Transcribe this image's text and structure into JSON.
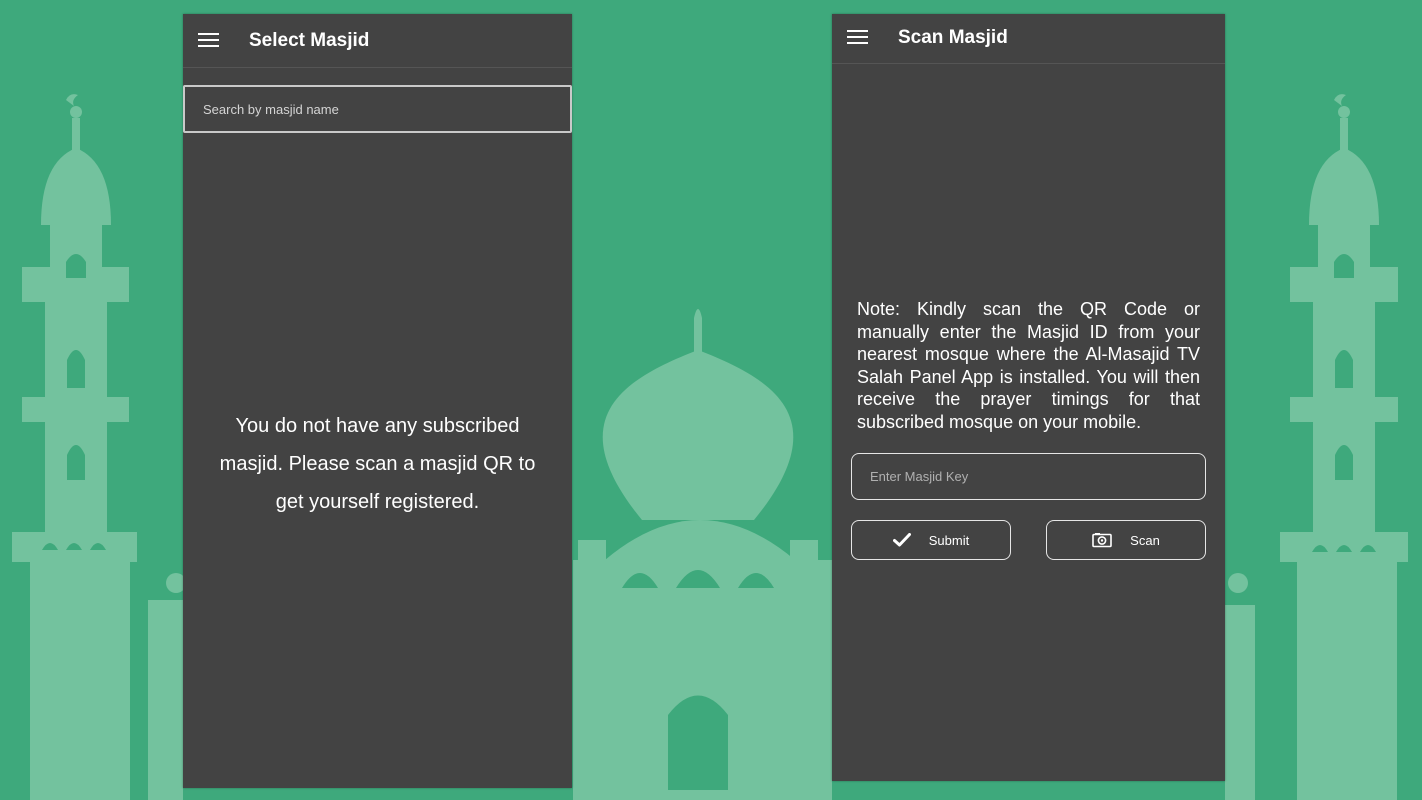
{
  "colors": {
    "background": "#3ea97c",
    "silhouette": "#73c29e",
    "panel": "#434343",
    "text": "#ffffff"
  },
  "select_screen": {
    "title": "Select Masjid",
    "menu_icon": "hamburger-menu-icon",
    "search_placeholder": "Search by masjid name",
    "empty_message": "You do not have any subscribed masjid. Please scan a masjid QR to get yourself registered."
  },
  "scan_screen": {
    "title": "Scan Masjid",
    "menu_icon": "hamburger-menu-icon",
    "note": "Note: Kindly scan the QR Code or manually enter the Masjid ID from your nearest mosque where the Al-Masajid TV Salah Panel App is installed. You will then receive the prayer timings for that subscribed mosque on your mobile.",
    "key_placeholder": "Enter Masjid Key",
    "submit_label": "Submit",
    "submit_icon": "checkmark-icon",
    "scan_label": "Scan",
    "scan_icon": "camera-icon"
  }
}
